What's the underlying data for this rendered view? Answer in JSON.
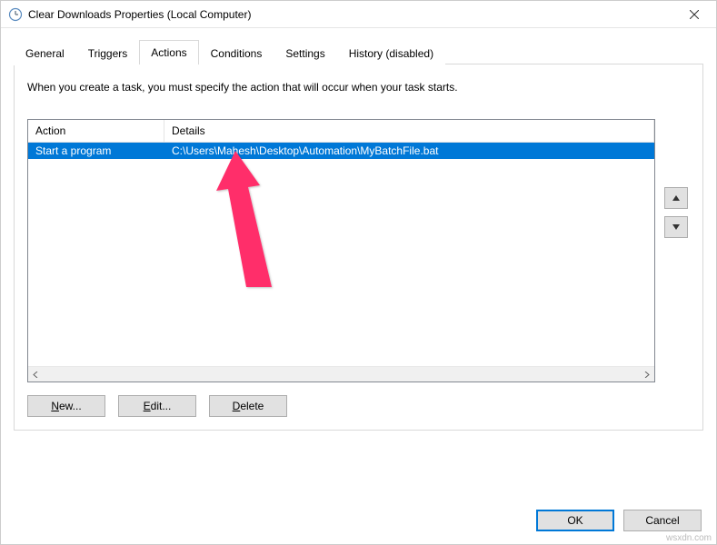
{
  "window": {
    "title": "Clear Downloads Properties (Local Computer)"
  },
  "tabs": {
    "general": "General",
    "triggers": "Triggers",
    "actions": "Actions",
    "conditions": "Conditions",
    "settings": "Settings",
    "history": "History (disabled)"
  },
  "instruction": "When you create a task, you must specify the action that will occur when your task starts.",
  "columns": {
    "action": "Action",
    "details": "Details"
  },
  "rows": [
    {
      "action": "Start a program",
      "details": "C:\\Users\\Mahesh\\Desktop\\Automation\\MyBatchFile.bat"
    }
  ],
  "buttons": {
    "new": "New...",
    "edit": "Edit...",
    "delete": "Delete",
    "ok": "OK",
    "cancel": "Cancel"
  },
  "watermark": "wsxdn.com"
}
